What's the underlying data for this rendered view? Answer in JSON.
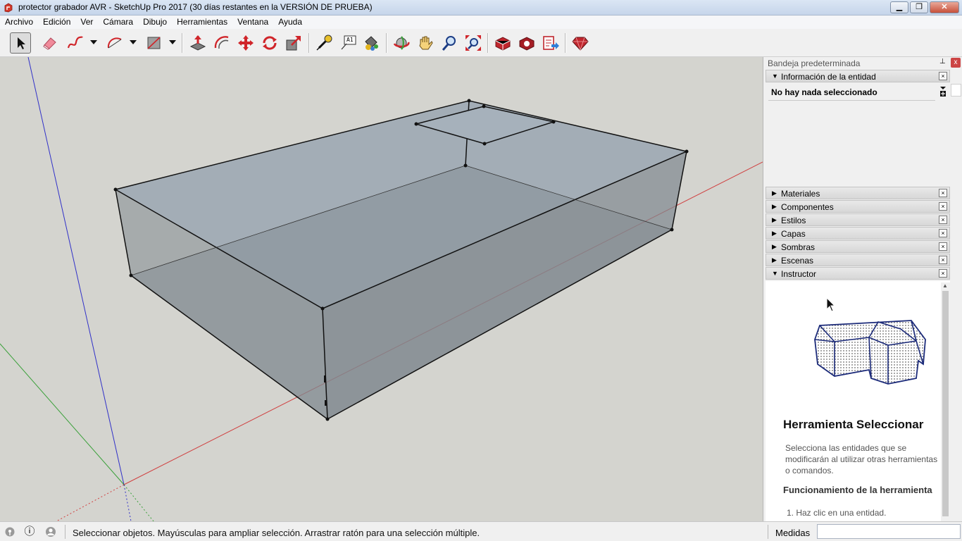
{
  "window": {
    "title": "protector grabador AVR - SketchUp Pro 2017 (30 días restantes en la VERSIÓN DE PRUEBA)",
    "minimize": "▁",
    "maximize": "❐",
    "close": "✕"
  },
  "menu": [
    "Archivo",
    "Edición",
    "Ver",
    "Cámara",
    "Dibujo",
    "Herramientas",
    "Ventana",
    "Ayuda"
  ],
  "toolbar": {
    "tools": [
      "select-tool-icon",
      "eraser-tool-icon",
      "freehand-tool-icon",
      "arc-tool-icon",
      "rectangle-tool-icon",
      "push-pull-tool-icon",
      "offset-tool-icon",
      "move-tool-icon",
      "rotate-tool-icon",
      "scale-tool-icon",
      "tape-measure-tool-icon",
      "text-tool-icon",
      "paint-bucket-tool-icon",
      "orbit-tool-icon",
      "pan-tool-icon",
      "zoom-tool-icon",
      "zoom-extents-tool-icon",
      "warehouse-tool-icon",
      "extension-warehouse-icon",
      "layout-send-icon",
      "ruby-console-icon"
    ],
    "text_tool_glyph": "A1"
  },
  "tray": {
    "title": "Bandeja predeterminada",
    "pin_glyph": "⊥",
    "close_glyph": "x",
    "entity_info": {
      "label": "Información de la entidad",
      "status": "No hay nada seleccionado"
    },
    "panels": [
      "Materiales",
      "Componentes",
      "Estilos",
      "Capas",
      "Sombras",
      "Escenas"
    ],
    "instructor": {
      "label": "Instructor",
      "title": "Herramienta Seleccionar",
      "description": "Selecciona las entidades que se modificarán al utilizar otras herramientas o comandos.",
      "subtitle": "Funcionamiento de la herramienta",
      "step": "1. Haz clic en una entidad."
    },
    "expanded_glyph": "▼",
    "collapsed_glyph": "▶",
    "panel_close_glyph": "×"
  },
  "status": {
    "message": "Seleccionar objetos. Mayúsculas para ampliar selección. Arrastrar ratón para una selección múltiple.",
    "measures_label": "Medidas",
    "measures_value": "",
    "info_glyph": "ⓘ"
  },
  "colors": {
    "viewport_bg": "#d4d4cf",
    "model_fill_top": "#9aa6b1",
    "model_fill_side": "#7f888f",
    "axis_red": "#d04040",
    "axis_green": "#3aa03a",
    "axis_blue": "#3030c8"
  }
}
